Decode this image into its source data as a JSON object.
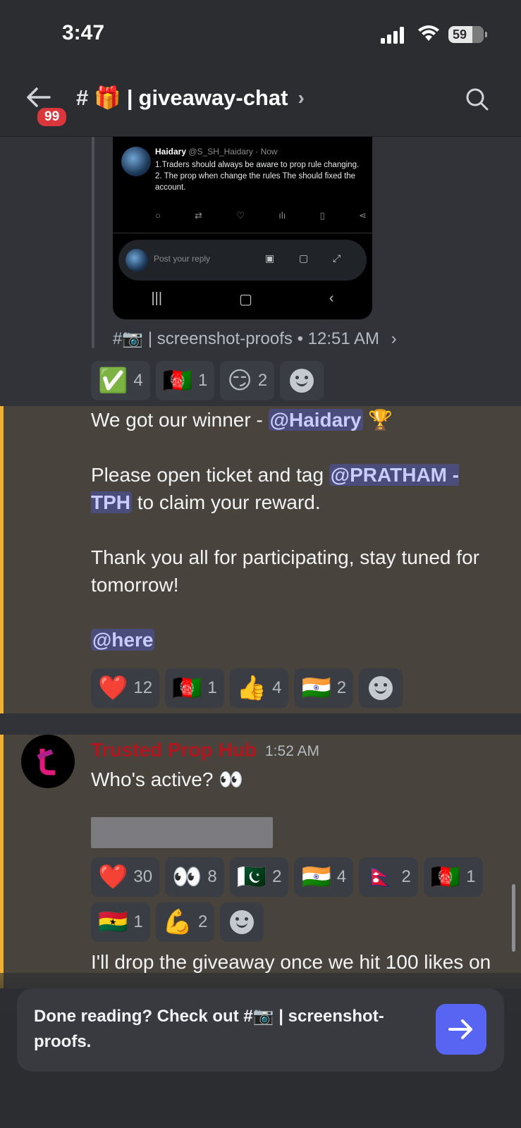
{
  "status_bar": {
    "time": "3:47",
    "battery": "59"
  },
  "header": {
    "unread_badge": "99",
    "hash": "#",
    "channel_emoji": "🎁",
    "separator": "|",
    "channel_name": "giveaway-chat",
    "chevron": "›"
  },
  "tweet": {
    "display_name": "Haidary",
    "handle_time": "@S_SH_Haidary · Now",
    "line1": "1.Traders should always be aware to prop rule changing.",
    "line2": "2. The prop when change the rules The should fixed the account.",
    "reply_placeholder": "Post your reply"
  },
  "source_line": {
    "text": "#📷 | screenshot-proofs • 12:51 AM",
    "chevron": "›"
  },
  "reactions_1": [
    {
      "emoji": "✅",
      "count": "4"
    },
    {
      "emoji": "🇦🇫",
      "count": "1"
    },
    {
      "emoji": "😏",
      "count": "2"
    }
  ],
  "message_1": {
    "winner_prefix": "We got our winner - ",
    "winner_mention": "@Haidary",
    "trophy": "🏆",
    "ticket_prefix": "Please open ticket and tag ",
    "ticket_mention": "@PRATHAM - TPH",
    "ticket_suffix": " to claim your reward.",
    "thanks": "Thank you all for participating, stay tuned for tomorrow!",
    "here_mention": "@here"
  },
  "reactions_2": [
    {
      "emoji": "❤️",
      "count": "12"
    },
    {
      "emoji": "🇦🇫",
      "count": "1"
    },
    {
      "emoji": "👍",
      "count": "4"
    },
    {
      "emoji": "🇮🇳",
      "count": "2"
    }
  ],
  "message_2": {
    "author": "Trusted Prop Hub",
    "timestamp": "1:52 AM",
    "text": "Who's active? 👀"
  },
  "reactions_3": [
    {
      "emoji": "❤️",
      "count": "30"
    },
    {
      "emoji": "👀",
      "count": "8"
    },
    {
      "emoji": "🇵🇰",
      "count": "2"
    },
    {
      "emoji": "🇮🇳",
      "count": "4"
    },
    {
      "emoji": "🇳🇵",
      "count": "2"
    },
    {
      "emoji": "🇦🇫",
      "count": "1"
    },
    {
      "emoji": "🇬🇭",
      "count": "1"
    },
    {
      "emoji": "💪",
      "count": "2"
    }
  ],
  "message_3": {
    "text": "I'll drop the giveaway once we hit 100 likes on"
  },
  "banner": {
    "text": "Done reading? Check out #📷 | screenshot-proofs."
  },
  "colors": {
    "accent": "#5865f2",
    "highlight_bar": "#f0b132",
    "author_red": "#b1151d",
    "mention_bg": "#4a4d7a"
  }
}
